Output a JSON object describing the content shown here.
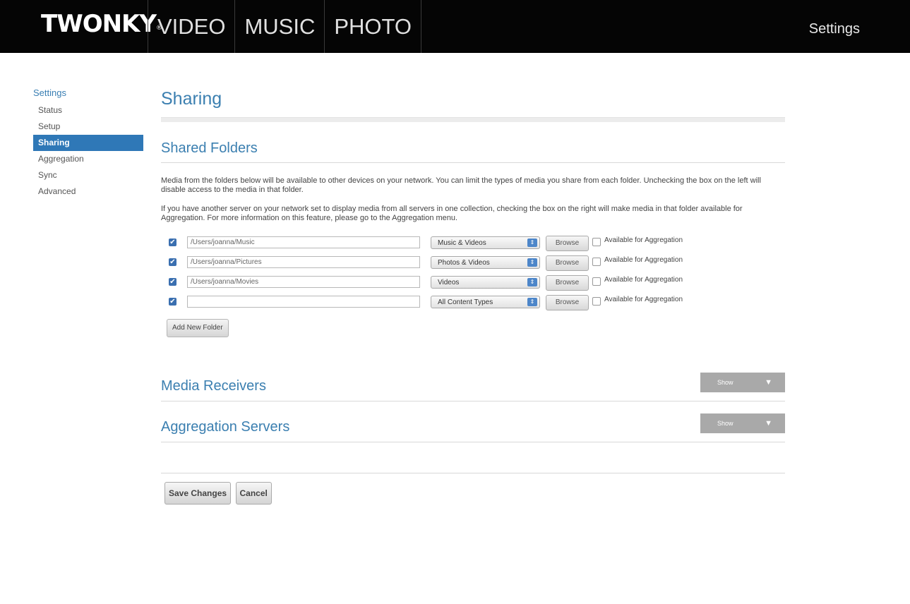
{
  "header": {
    "logo": "TWONKY",
    "logo_mark": "®",
    "tabs": [
      "VIDEO",
      "MUSIC",
      "PHOTO"
    ],
    "settings_link": "Settings"
  },
  "sidebar": {
    "title": "Settings",
    "items": [
      {
        "label": "Status",
        "active": false
      },
      {
        "label": "Setup",
        "active": false
      },
      {
        "label": "Sharing",
        "active": true
      },
      {
        "label": "Aggregation",
        "active": false
      },
      {
        "label": "Sync",
        "active": false
      },
      {
        "label": "Advanced",
        "active": false
      }
    ]
  },
  "main": {
    "title": "Sharing",
    "shared_folders": {
      "title": "Shared Folders",
      "paragraph1": "Media from the folders below will be available to other devices on your network. You can limit the types of media you share from each folder. Unchecking the box on the left will disable access to the media in that folder.",
      "paragraph2": "If you have another server on your network set to display media from all servers in one collection, checking the box on the right will make media in that folder available for Aggregation. For more information on this feature, please go to the Aggregation menu.",
      "rows": [
        {
          "enabled": true,
          "path": "/Users/joanna/Music",
          "type": "Music & Videos",
          "browse": "Browse",
          "aggregation_checked": false,
          "aggregation_label": "Available for Aggregation"
        },
        {
          "enabled": true,
          "path": "/Users/joanna/Pictures",
          "type": "Photos & Videos",
          "browse": "Browse",
          "aggregation_checked": false,
          "aggregation_label": "Available for Aggregation"
        },
        {
          "enabled": true,
          "path": "/Users/joanna/Movies",
          "type": "Videos",
          "browse": "Browse",
          "aggregation_checked": false,
          "aggregation_label": "Available for Aggregation"
        },
        {
          "enabled": true,
          "path": "",
          "type": "All Content Types",
          "browse": "Browse",
          "aggregation_checked": false,
          "aggregation_label": "Available for Aggregation"
        }
      ],
      "add_folder_label": "Add New Folder"
    },
    "media_receivers": {
      "title": "Media Receivers",
      "button_label": "Show"
    },
    "aggregation_servers": {
      "title": "Aggregation Servers",
      "button_label": "Show"
    },
    "save_label": "Save Changes",
    "cancel_label": "Cancel"
  },
  "colors": {
    "topbar": "#050505",
    "accent": "#2f78b7",
    "heading": "#3b7fb0",
    "show_button": "#a9a9a9"
  },
  "icons": {
    "checkbox_checked": "check-icon",
    "select_arrow": "updown-arrow-icon",
    "show_toggle": "triangle-down-icon"
  }
}
